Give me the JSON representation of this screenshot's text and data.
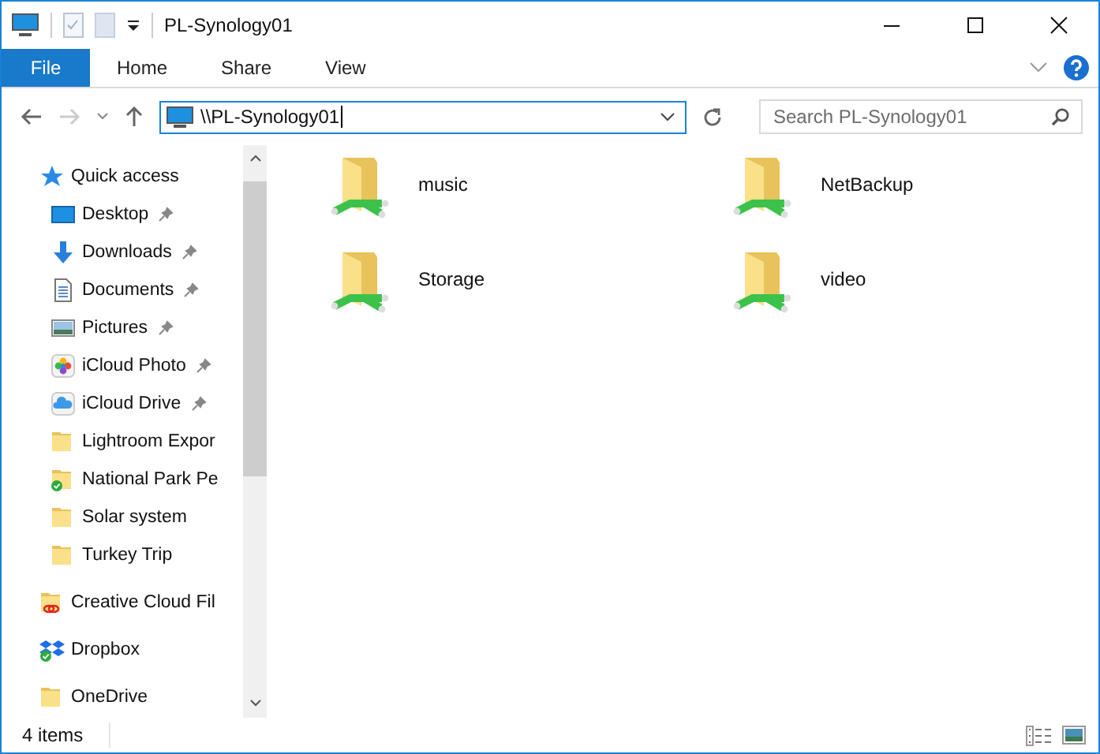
{
  "window": {
    "title": "PL-Synology01"
  },
  "tabs": [
    {
      "label": "File",
      "kind": "file"
    },
    {
      "label": "Home",
      "kind": "tab"
    },
    {
      "label": "Share",
      "kind": "tab"
    },
    {
      "label": "View",
      "kind": "tab"
    }
  ],
  "address": {
    "value": "\\\\PL-Synology01"
  },
  "search": {
    "placeholder": "Search PL-Synology01"
  },
  "sidebar": {
    "items": [
      {
        "label": "Quick access",
        "kind": "star",
        "pinned": false,
        "children": [
          {
            "label": "Desktop",
            "kind": "desktop",
            "pinned": true
          },
          {
            "label": "Downloads",
            "kind": "download",
            "pinned": true
          },
          {
            "label": "Documents",
            "kind": "document",
            "pinned": true
          },
          {
            "label": "Pictures",
            "kind": "picture",
            "pinned": true
          },
          {
            "label": "iCloud Photo",
            "kind": "photos",
            "pinned": true
          },
          {
            "label": "iCloud Drive",
            "kind": "cloud",
            "pinned": true
          },
          {
            "label": "Lightroom Expor",
            "kind": "folder",
            "pinned": false
          },
          {
            "label": "National Park Pe",
            "kind": "synced",
            "pinned": false
          },
          {
            "label": "Solar system",
            "kind": "folder",
            "pinned": false
          },
          {
            "label": "Turkey Trip",
            "kind": "folder",
            "pinned": false
          }
        ]
      },
      {
        "label": "Creative Cloud Fil",
        "kind": "creative",
        "pinned": false
      },
      {
        "label": "Dropbox",
        "kind": "dropbox",
        "pinned": false
      },
      {
        "label": "OneDrive",
        "kind": "folder",
        "pinned": false
      }
    ]
  },
  "shares": [
    {
      "name": "music"
    },
    {
      "name": "NetBackup"
    },
    {
      "name": "Storage"
    },
    {
      "name": "video"
    }
  ],
  "status_bar": {
    "count": "4 items"
  }
}
